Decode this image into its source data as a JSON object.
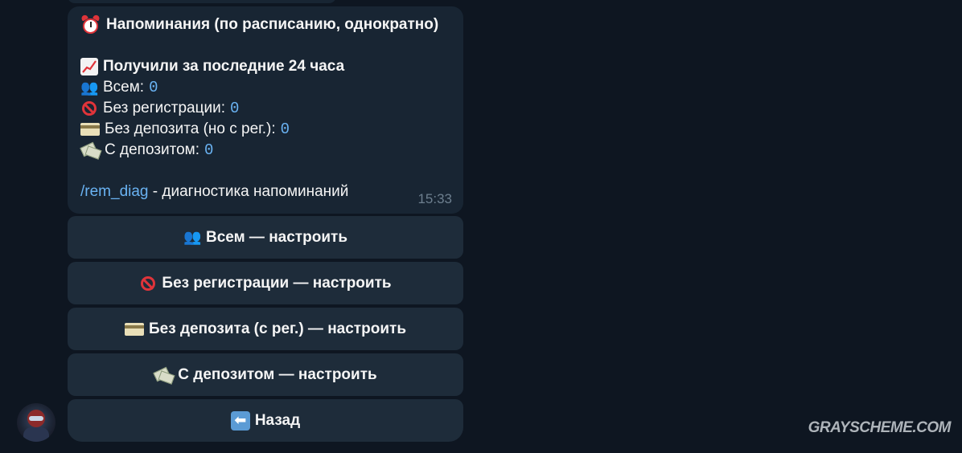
{
  "message": {
    "title_icon": "alarm-clock-icon",
    "title": "Напоминания (по расписанию, однократно)",
    "stats_icon": "chart-increasing-icon",
    "stats_title": "Получили за последние 24 часа",
    "rows": [
      {
        "icon": "people-icon",
        "label": "Всем:",
        "value": "0"
      },
      {
        "icon": "no-entry-icon",
        "label": "Без регистрации:",
        "value": "0"
      },
      {
        "icon": "credit-card-icon",
        "label": "Без депозита (но с рег.):",
        "value": "0"
      },
      {
        "icon": "money-wings-icon",
        "label": "С депозитом:",
        "value": "0"
      }
    ],
    "command": "/rem_diag",
    "command_desc": " - диагностика напоминаний",
    "time": "15:33"
  },
  "keyboard": [
    {
      "icon": "people-icon",
      "label": "Всем — настроить"
    },
    {
      "icon": "no-entry-icon",
      "label": "Без регистрации — настроить"
    },
    {
      "icon": "credit-card-icon",
      "label": "Без депозита (с рег.) — настроить"
    },
    {
      "icon": "money-wings-icon",
      "label": "С депозитом — настроить"
    },
    {
      "icon": "back-arrow-icon",
      "label": "Назад"
    }
  ],
  "watermark": "GRAYSCHEME.COM"
}
